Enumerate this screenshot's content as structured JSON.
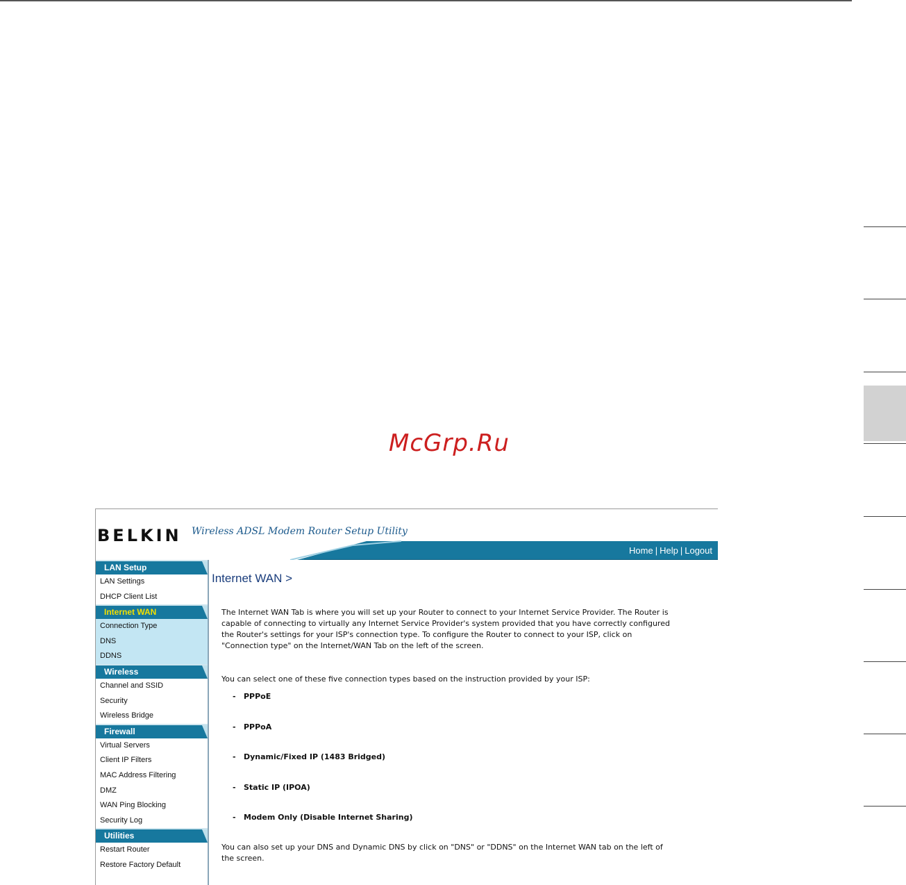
{
  "watermark": "McGrp.Ru",
  "header": {
    "logo": "BELKIN",
    "tagline": "Wireless ADSL Modem Router Setup Utility",
    "links": [
      "Home",
      "Help",
      "Logout"
    ],
    "separator": "|",
    "accent_color": "#17789e"
  },
  "sidebar": {
    "lan_setup": {
      "title": "LAN Setup",
      "items": [
        "LAN Settings",
        "DHCP Client List"
      ]
    },
    "internet_wan": {
      "title": "Internet WAN",
      "items": [
        "Connection Type",
        "DNS",
        "DDNS"
      ]
    },
    "wireless": {
      "title": "Wireless",
      "items": [
        "Channel and SSID",
        "Security",
        "Wireless Bridge"
      ]
    },
    "firewall": {
      "title": "Firewall",
      "items": [
        "Virtual Servers",
        "Client IP Filters",
        "MAC Address Filtering",
        "DMZ",
        "WAN Ping Blocking",
        "Security Log"
      ]
    },
    "utilities": {
      "title": "Utilities",
      "items": [
        "Restart Router",
        "Restore Factory Default"
      ]
    }
  },
  "main": {
    "title": "Internet WAN >",
    "intro": "The Internet WAN Tab is where you will set up your Router to connect to your Internet Service Provider. The Router is capable of connecting to virtually any Internet Service Provider's system provided that you have correctly configured the Router's settings for your ISP's connection type. To configure the Router to connect to your ISP, click on \"Connection type\" on the Internet/WAN Tab on the left of the screen.",
    "select_text": "You can select one of these five connection types based on the instruction provided by your ISP:",
    "bullet": "-",
    "types": [
      "PPPoE",
      "PPPoA",
      "Dynamic/Fixed IP (1483 Bridged)",
      "Static IP (IPOA)",
      "Modem Only (Disable Internet Sharing)"
    ],
    "footer": "You can also set up your DNS and Dynamic DNS by click on \"DNS\" or \"DDNS\" on the Internet WAN tab on the left of the screen."
  }
}
